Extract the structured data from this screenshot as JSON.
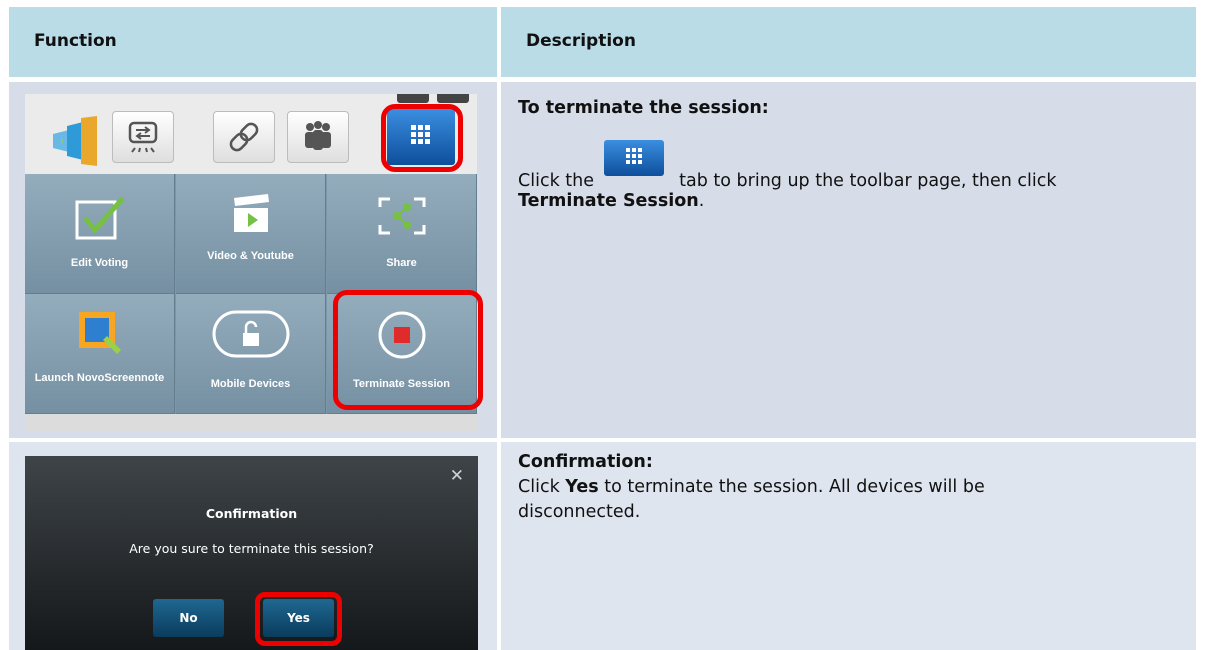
{
  "table": {
    "headers": [
      "Function",
      "Description"
    ],
    "rows": [
      {
        "title": "To terminate the session:",
        "text_click": "Click the",
        "text_after": "tab to bring up the toolbar page, then click",
        "text_bold": "Terminate Session",
        "text_end": "."
      },
      {
        "title": "Confirmation:",
        "text_click": "Click",
        "text_bold": "Yes",
        "text_after": "to terminate the session. All devices will be disconnected."
      }
    ]
  },
  "toolbar": {
    "tiles": [
      "Edit Voting",
      "Video & Youtube",
      "Share",
      "Launch NovoScreennote",
      "Mobile Devices",
      "Terminate Session"
    ]
  },
  "dialog": {
    "title": "Confirmation",
    "message": "Are you sure to terminate this session?",
    "no_label": "No",
    "yes_label": "Yes",
    "close_glyph": "✕"
  },
  "colors": {
    "header_bg": "#b9dce7",
    "row1_bg": "#d6dde9",
    "row2_bg": "#dfe5ef",
    "highlight": "#ee0000",
    "tile_bg": "#7c97a9",
    "apps_button": "#1a73c9"
  }
}
